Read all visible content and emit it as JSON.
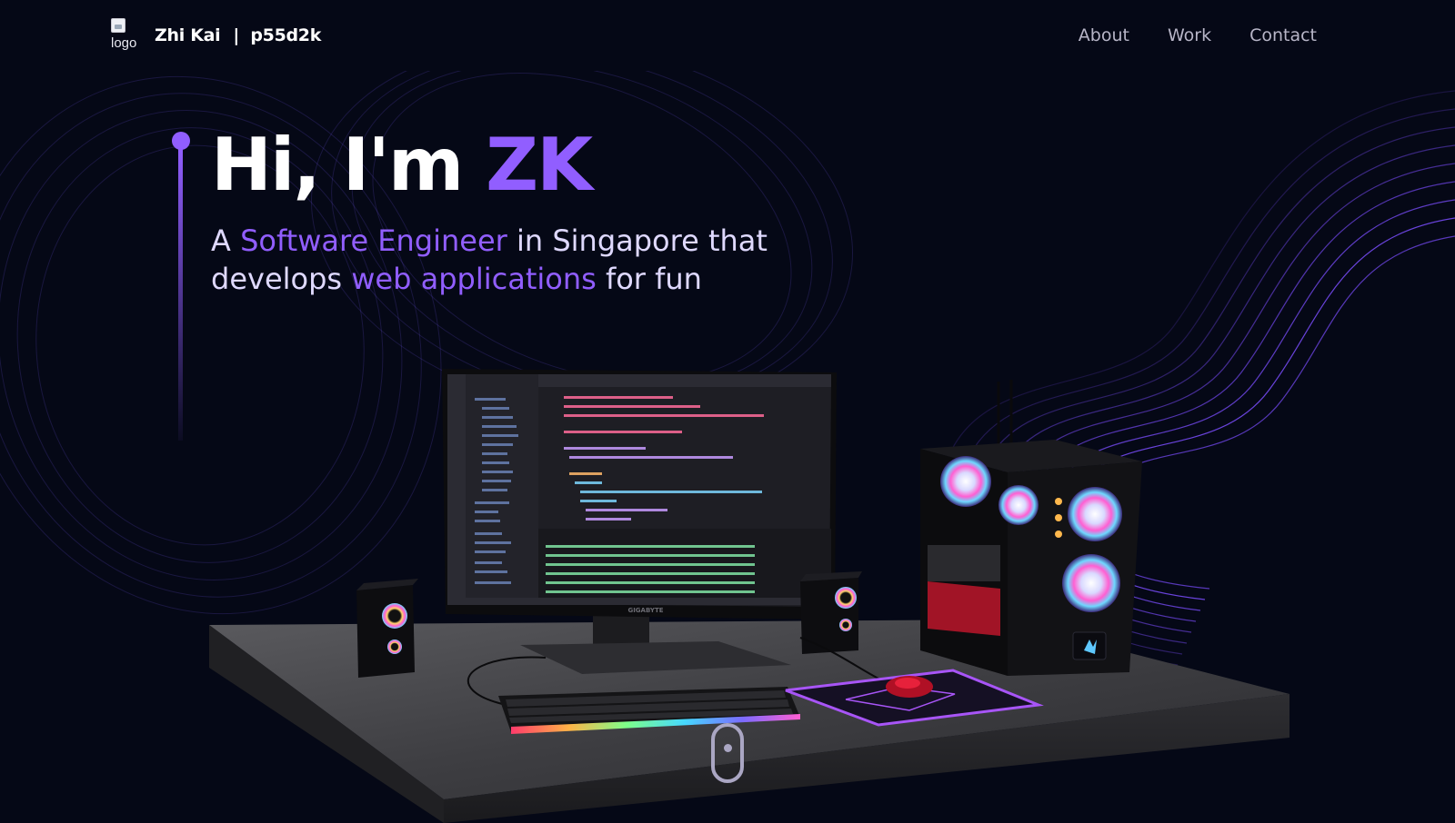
{
  "navbar": {
    "logo_alt": "logo",
    "name": "Zhi Kai",
    "separator": "|",
    "handle": "p55d2k",
    "links": [
      "About",
      "Work",
      "Contact"
    ]
  },
  "hero": {
    "title_prefix": "Hi, I'm ",
    "title_highlight": "ZK",
    "sub_1": "A ",
    "sub_hl_1": "Software Engineer",
    "sub_2": " in Singapore that develops ",
    "sub_hl_2": "web applications",
    "sub_3": " for fun"
  },
  "scene": {
    "monitor_brand": "GIGABYTE"
  },
  "colors": {
    "background": "#050816",
    "accent": "#915eff",
    "nav_text": "#b7b5c7"
  },
  "icons": [
    "scroll-mouse-icon"
  ]
}
